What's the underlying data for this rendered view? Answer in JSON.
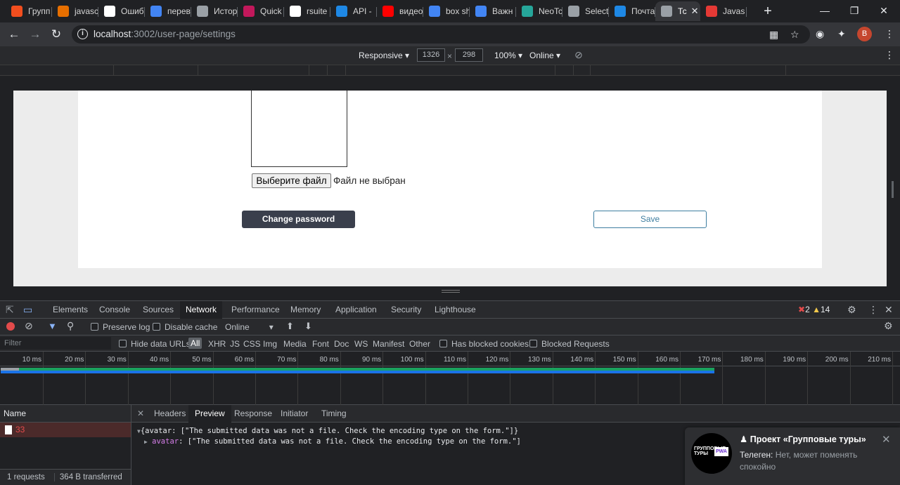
{
  "tabs": [
    {
      "title": "Групп",
      "icon": "figma-icon",
      "color": "#f24e1e"
    },
    {
      "title": "javasc",
      "icon": "java-icon",
      "color": "#e76f00"
    },
    {
      "title": "Ошиб",
      "icon": "wikipedia-icon",
      "color": "#ffffff"
    },
    {
      "title": "перев",
      "icon": "google-icon",
      "color": "#4285f4"
    },
    {
      "title": "Истор",
      "icon": "history-icon",
      "color": "#9aa0a6"
    },
    {
      "title": "Quick",
      "icon": "quick-icon",
      "color": "#c2185b"
    },
    {
      "title": "rsuite",
      "icon": "github-icon",
      "color": "#ffffff"
    },
    {
      "title": "API -",
      "icon": "api-icon",
      "color": "#1e88e5"
    },
    {
      "title": "видео",
      "icon": "youtube-icon",
      "color": "#ff0000"
    },
    {
      "title": "box sh",
      "icon": "google-icon",
      "color": "#4285f4"
    },
    {
      "title": "Важн",
      "icon": "docs-icon",
      "color": "#4285f4"
    },
    {
      "title": "NeoTc",
      "icon": "neo-icon",
      "color": "#26a69a"
    },
    {
      "title": "Select",
      "icon": "globe-icon",
      "color": "#9aa0a6"
    },
    {
      "title": "Почта",
      "icon": "mail-icon",
      "color": "#1e88e5"
    },
    {
      "title": "Тс",
      "icon": "globe-icon",
      "color": "#9aa0a6"
    },
    {
      "title": "Javas",
      "icon": "code-icon",
      "color": "#e53935"
    }
  ],
  "address": {
    "host": "localhost",
    "path": ":3002/user-page/settings"
  },
  "profile_initial": "В",
  "device": {
    "mode": "Responsive",
    "width": "1326",
    "times": "×",
    "height": "298",
    "zoom": "100%",
    "network": "Online"
  },
  "page": {
    "file_button": "Выберите файл",
    "file_status": "Файл не выбран",
    "change_password": "Change password",
    "save": "Save"
  },
  "devtools": {
    "tabs": [
      "Elements",
      "Console",
      "Sources",
      "Network",
      "Performance",
      "Memory",
      "Application",
      "Security",
      "Lighthouse"
    ],
    "active_tab": "Network",
    "errors": "2",
    "warnings": "14",
    "toolbar": {
      "preserve_log": "Preserve log",
      "disable_cache": "Disable cache",
      "throttle": "Online"
    },
    "filter": {
      "placeholder": "Filter",
      "hide_data_urls": "Hide data URLs",
      "types": [
        "All",
        "XHR",
        "JS",
        "CSS",
        "Img",
        "Media",
        "Font",
        "Doc",
        "WS",
        "Manifest",
        "Other"
      ],
      "has_blocked_cookies": "Has blocked cookies",
      "blocked_requests": "Blocked Requests"
    },
    "timeline_labels": [
      "10 ms",
      "20 ms",
      "30 ms",
      "40 ms",
      "50 ms",
      "60 ms",
      "70 ms",
      "80 ms",
      "90 ms",
      "100 ms",
      "110 ms",
      "120 ms",
      "130 ms",
      "140 ms",
      "150 ms",
      "160 ms",
      "170 ms",
      "180 ms",
      "190 ms",
      "200 ms",
      "210 ms"
    ],
    "request_list": {
      "header": "Name",
      "row_name": "33",
      "footer_requests": "1 requests",
      "footer_transferred": "364 B transferred"
    },
    "detail_tabs": [
      "Headers",
      "Preview",
      "Response",
      "Initiator",
      "Timing"
    ],
    "active_detail_tab": "Preview",
    "preview": {
      "line1": "{avatar: [\"The submitted data was not a file. Check the encoding type on the form.\"]}",
      "key": "avatar",
      "line2_value": ": [\"The submitted data was not a file. Check the encoding type on the form.\"]"
    }
  },
  "notification": {
    "title": "Проект «Групповые туры»",
    "sender": "Телеген:",
    "message": "Нет, может поменять спокойно",
    "logo_text": "ГРУППОВЫЕ ТУРЫ",
    "logo_badge": "PWA"
  }
}
